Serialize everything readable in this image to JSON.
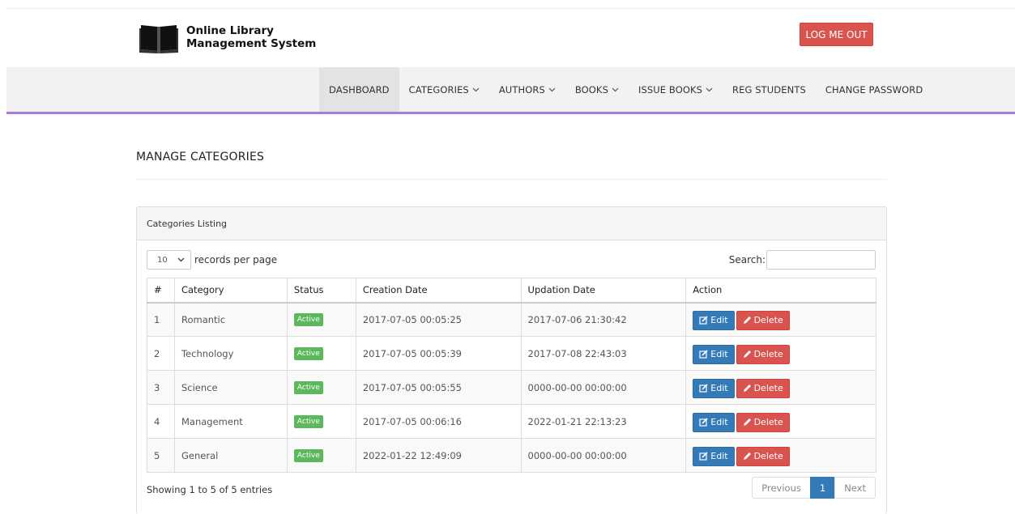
{
  "header": {
    "title_line1": "Online Library",
    "title_line2": "Management System",
    "logout_label": "LOG ME OUT"
  },
  "nav": {
    "items": [
      {
        "label": "DASHBOARD",
        "dropdown": false
      },
      {
        "label": "CATEGORIES",
        "dropdown": true
      },
      {
        "label": "AUTHORS",
        "dropdown": true
      },
      {
        "label": "BOOKS",
        "dropdown": true
      },
      {
        "label": "ISSUE BOOKS",
        "dropdown": true
      },
      {
        "label": "REG STUDENTS",
        "dropdown": false
      },
      {
        "label": "CHANGE PASSWORD",
        "dropdown": false
      }
    ],
    "active_index": 0,
    "accent_color": "#a97be0"
  },
  "page": {
    "title": "MANAGE CATEGORIES"
  },
  "panel": {
    "heading": "Categories Listing",
    "length_value": "10",
    "length_label": "records per page",
    "search_label": "Search:",
    "search_value": "",
    "columns": [
      "#",
      "Category",
      "Status",
      "Creation Date",
      "Updation Date",
      "Action"
    ],
    "rows": [
      {
        "num": "1",
        "category": "Romantic",
        "status": "Active",
        "created": "2017-07-05 00:05:25",
        "updated": "2017-07-06 21:30:42"
      },
      {
        "num": "2",
        "category": "Technology",
        "status": "Active",
        "created": "2017-07-05 00:05:39",
        "updated": "2017-07-08 22:43:03"
      },
      {
        "num": "3",
        "category": "Science",
        "status": "Active",
        "created": "2017-07-05 00:05:55",
        "updated": "0000-00-00 00:00:00"
      },
      {
        "num": "4",
        "category": "Management",
        "status": "Active",
        "created": "2017-07-05 00:06:16",
        "updated": "2022-01-21 22:13:23"
      },
      {
        "num": "5",
        "category": "General",
        "status": "Active",
        "created": "2022-01-22 12:49:09",
        "updated": "0000-00-00 00:00:00"
      }
    ],
    "edit_label": "Edit",
    "delete_label": "Delete",
    "info": "Showing 1 to 5 of 5 entries",
    "pager": {
      "prev": "Previous",
      "current": "1",
      "next": "Next"
    }
  }
}
